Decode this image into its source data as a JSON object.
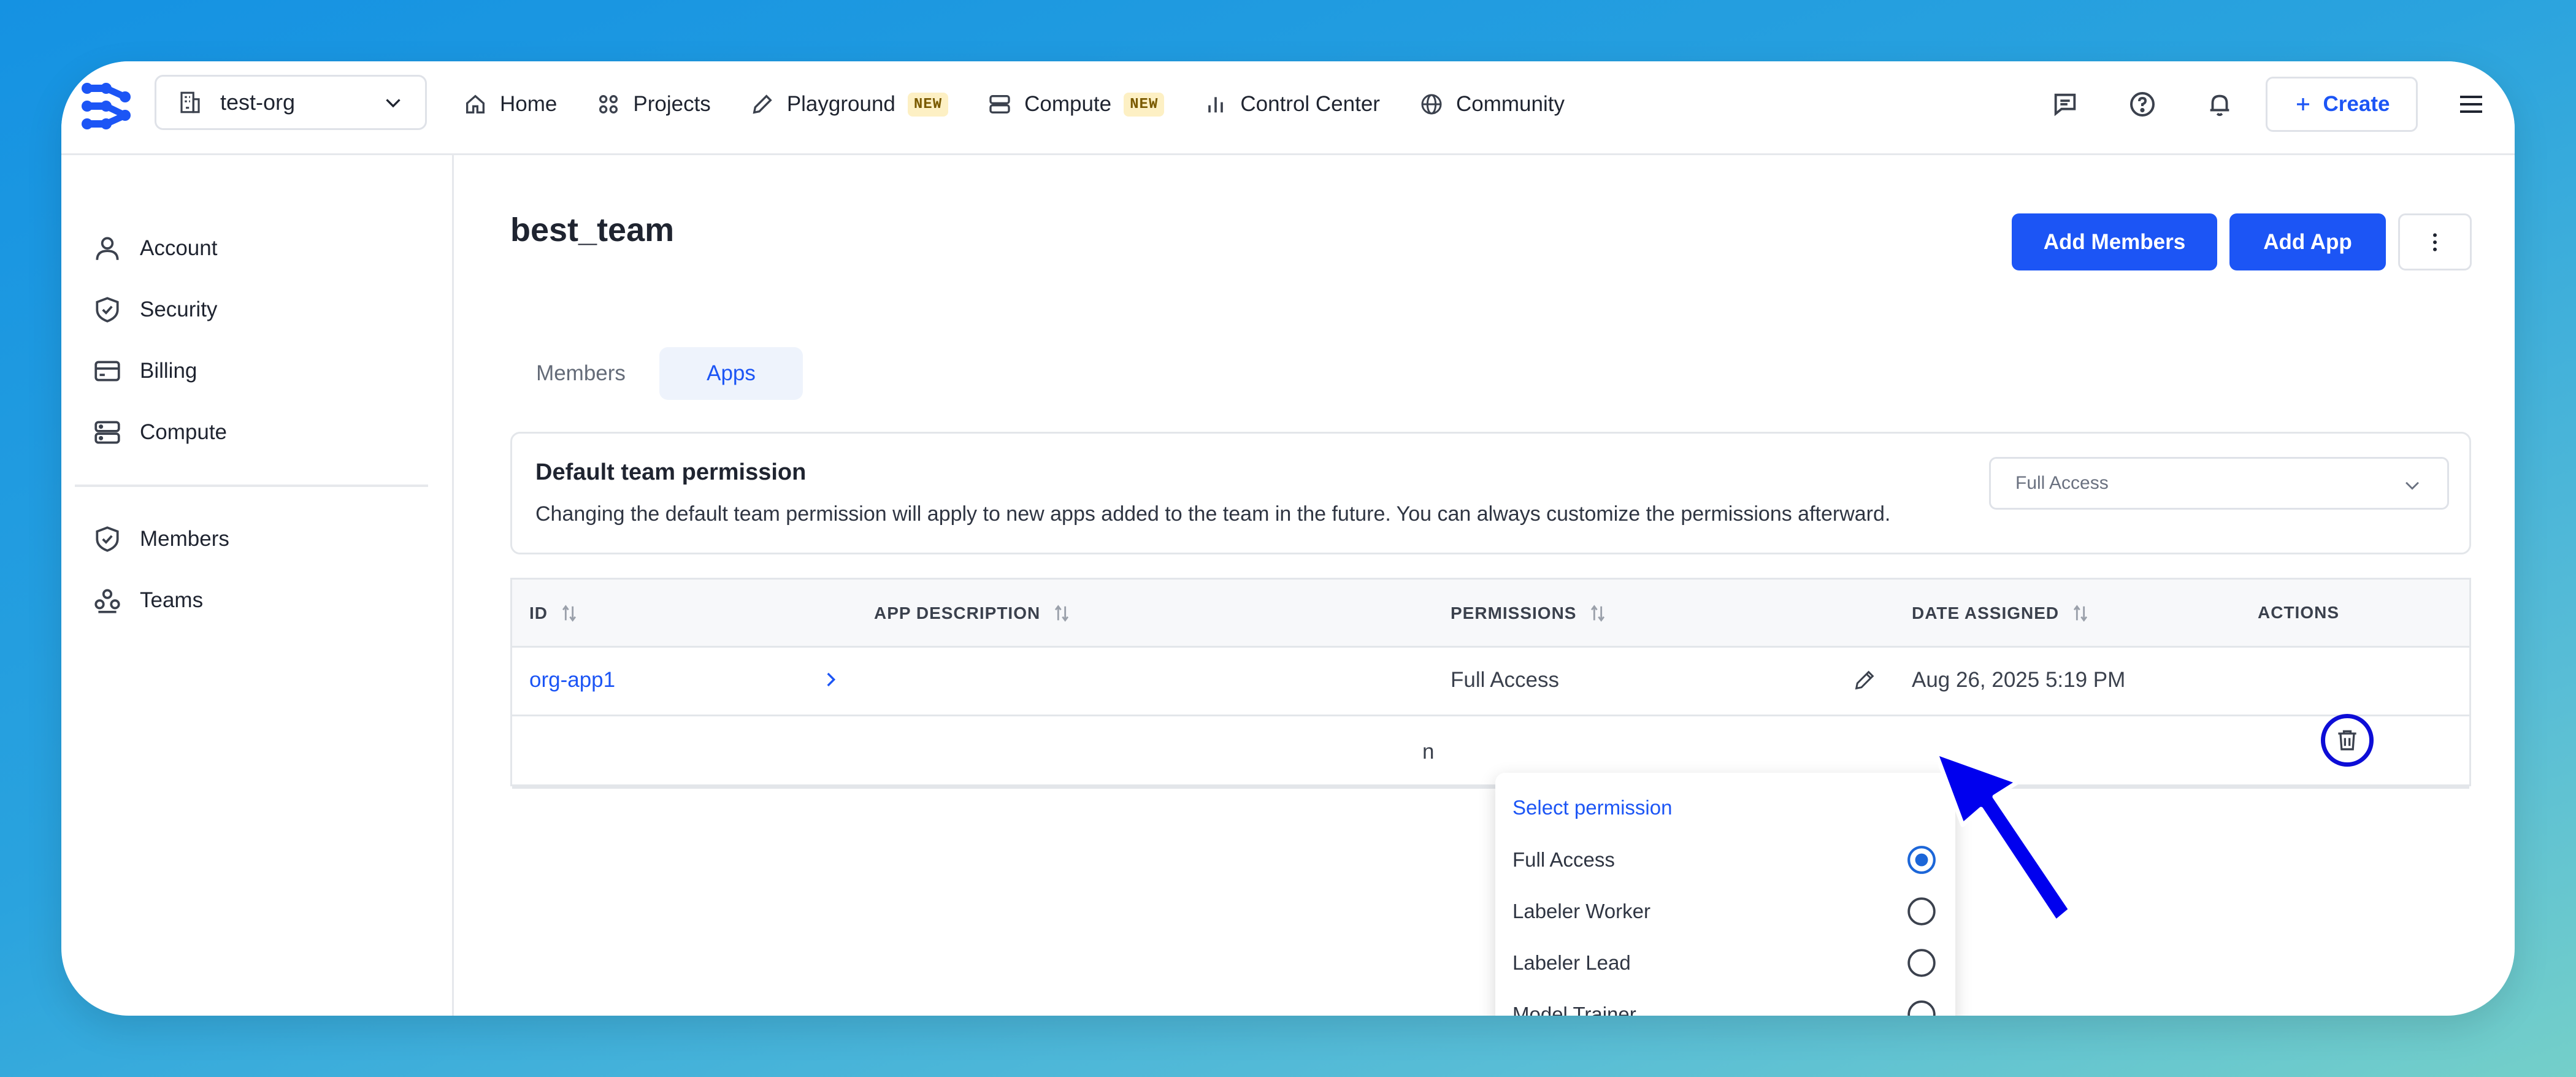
{
  "org_selector": {
    "name": "test-org"
  },
  "nav": {
    "home": "Home",
    "projects": "Projects",
    "playground": "Playground",
    "playground_badge": "NEW",
    "compute": "Compute",
    "compute_badge": "NEW",
    "control_center": "Control Center",
    "community": "Community"
  },
  "topbar": {
    "create_label": "Create"
  },
  "sidebar": {
    "items": [
      {
        "label": "Account"
      },
      {
        "label": "Security"
      },
      {
        "label": "Billing"
      },
      {
        "label": "Compute"
      },
      {
        "label": "Members"
      },
      {
        "label": "Teams"
      }
    ]
  },
  "page": {
    "title": "best_team",
    "add_members": "Add Members",
    "add_app": "Add App"
  },
  "tabs": {
    "members": "Members",
    "apps": "Apps"
  },
  "default_permission": {
    "title": "Default team permission",
    "description": "Changing the default team permission will apply to new apps added to the team in the future. You can always customize the permissions afterward.",
    "selected": "Full Access"
  },
  "table": {
    "headers": {
      "id": "ID",
      "app_description": "APP DESCRIPTION",
      "permissions": "PERMISSIONS",
      "date_assigned": "DATE ASSIGNED",
      "actions": "ACTIONS"
    },
    "rows": [
      {
        "id": "org-app1",
        "description": "",
        "permission": "Full Access",
        "date_assigned": "Aug 26, 2025 5:19 PM"
      }
    ],
    "partial_row_text": "n"
  },
  "permission_dropdown": {
    "header": "Select permission",
    "options": [
      {
        "label": "Full Access",
        "selected": true
      },
      {
        "label": "Labeler Worker",
        "selected": false
      },
      {
        "label": "Labeler Lead",
        "selected": false
      },
      {
        "label": "Model Trainer",
        "selected": false
      }
    ]
  },
  "colors": {
    "accent": "#1c55f5",
    "annotation": "#0d0dd6"
  }
}
